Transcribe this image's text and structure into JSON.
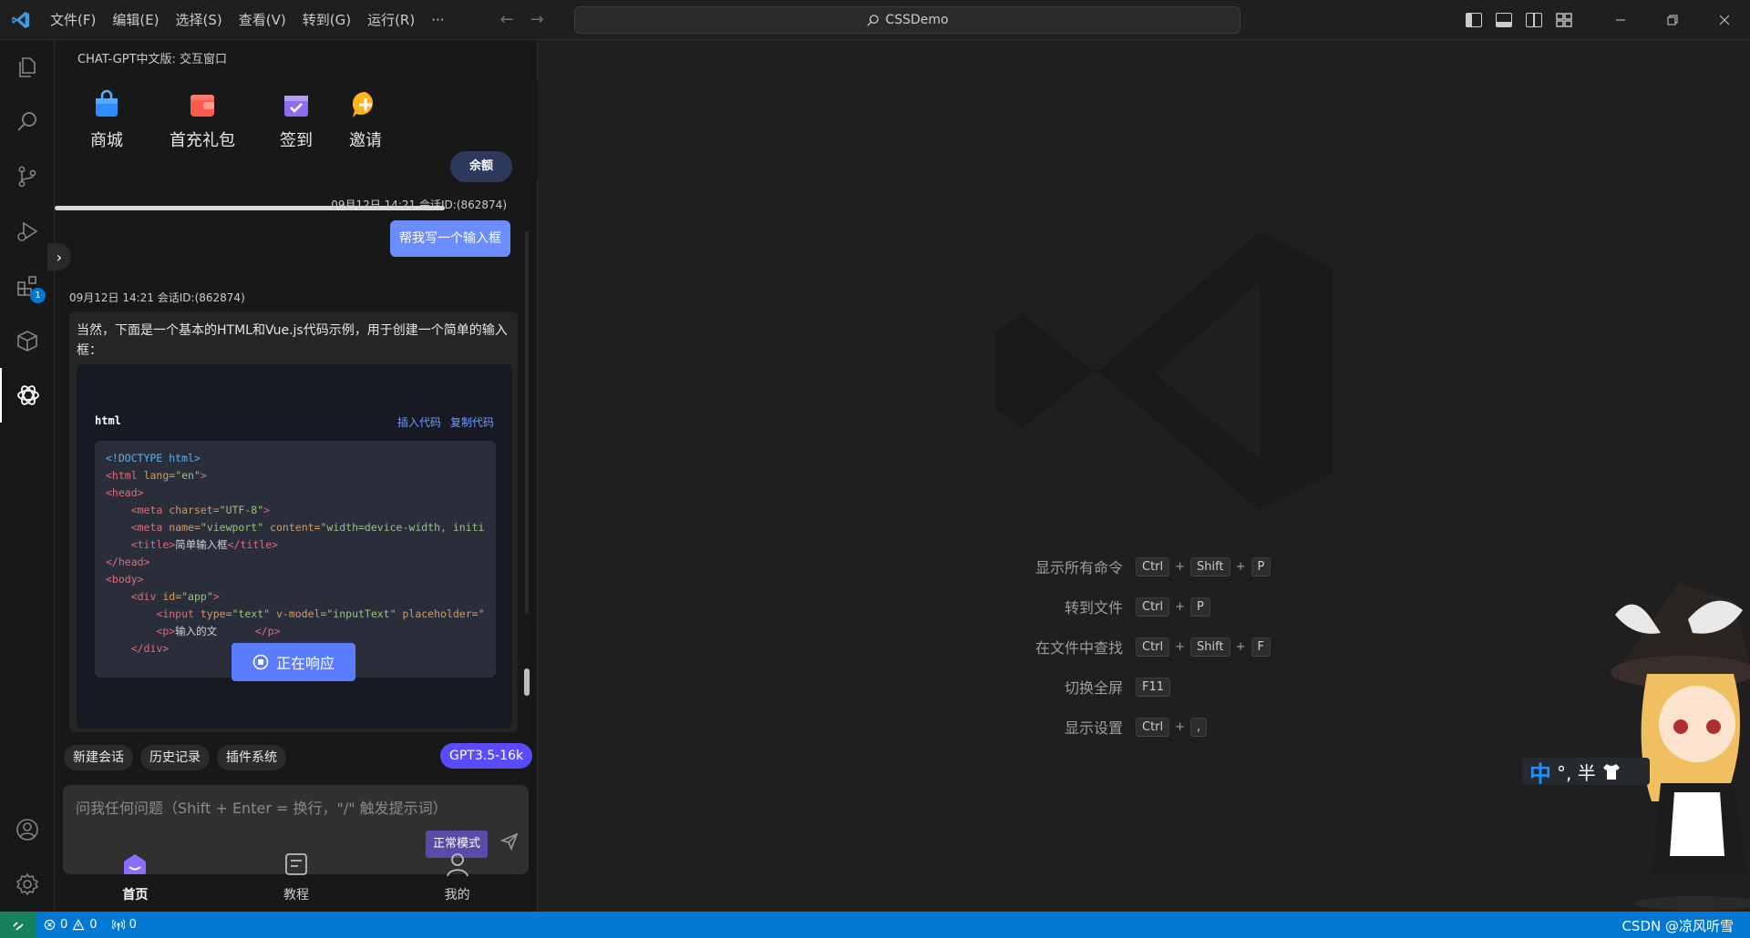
{
  "titlebar": {
    "menu": [
      "文件(F)",
      "编辑(E)",
      "选择(S)",
      "查看(V)",
      "转到(G)",
      "运行(R)",
      "···"
    ],
    "search_text": "CSSDemo"
  },
  "activity": {
    "extensions_badge": "1"
  },
  "panel": {
    "title": "CHAT-GPT中文版: 交互窗口",
    "quick": [
      "商城",
      "首充礼包",
      "签到",
      "邀请"
    ],
    "balance": "余额"
  },
  "chat": {
    "user_meta": "09月12日 14:21 会话ID:(862874)",
    "user_message": "帮我写一个输入框",
    "bot_meta": "09月12日 14:21 会话ID:(862874)",
    "bot_text": "当然，下面是一个基本的HTML和Vue.js代码示例，用于创建一个简单的输入框：",
    "code_lang": "html",
    "insert_code": "插入代码",
    "copy_code": "复制代码",
    "responding": "正在响应"
  },
  "tools": [
    "新建会话",
    "历史记录",
    "插件系统"
  ],
  "model": "GPT3.5-16k",
  "input": {
    "placeholder": "问我任何问题（Shift + Enter = 换行，\"/\" 触发提示词）",
    "mode": "正常模式"
  },
  "bottom_nav": [
    "首页",
    "教程",
    "我的"
  ],
  "shortcuts": [
    {
      "label": "显示所有命令",
      "keys": [
        "Ctrl",
        "Shift",
        "P"
      ]
    },
    {
      "label": "转到文件",
      "keys": [
        "Ctrl",
        "P"
      ]
    },
    {
      "label": "在文件中查找",
      "keys": [
        "Ctrl",
        "Shift",
        "F"
      ]
    },
    {
      "label": "切换全屏",
      "keys": [
        "F11"
      ]
    },
    {
      "label": "显示设置",
      "keys": [
        "Ctrl",
        ","
      ]
    }
  ],
  "ime": {
    "zh": "中",
    "rest": "°, 半"
  },
  "status": {
    "errors": "0",
    "warnings": "0",
    "ports": "0",
    "watermark": "CSDN @凉风听雪"
  },
  "colors": {
    "accent": "#0078d4",
    "bubble": "#6b8dff",
    "model_chip": "#5a4bff"
  }
}
